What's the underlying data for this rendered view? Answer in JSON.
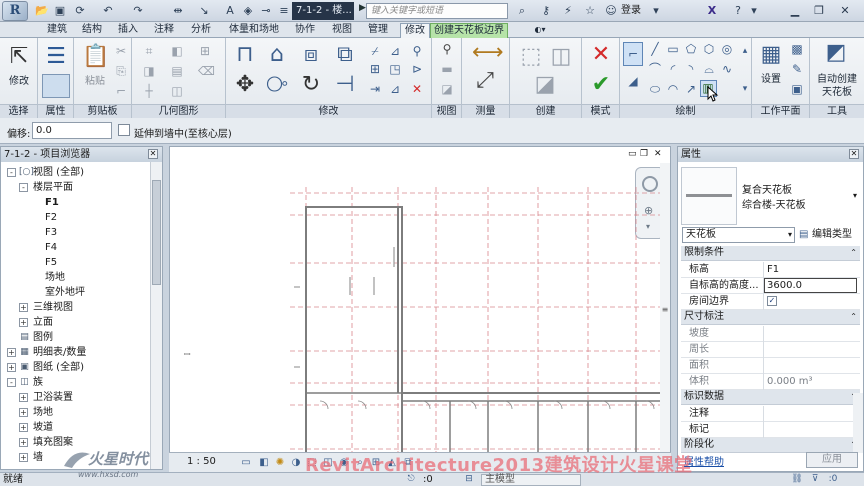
{
  "titlebar": {
    "logo": "R",
    "document_title": "7-1-2 - 楼...",
    "search_placeholder": "键入关键字或短语",
    "login": "登录"
  },
  "tabs": [
    "建筑",
    "结构",
    "插入",
    "注释",
    "分析",
    "体量和场地",
    "协作",
    "视图",
    "管理",
    "修改",
    "创建天花板边界"
  ],
  "tabs_state": {
    "active": "修改",
    "context": "创建天花板边界"
  },
  "ribbon": {
    "panels": {
      "select": "选择",
      "properties": "属性",
      "clipboard": "剪贴板",
      "geometry": "几何图形",
      "modify": "修改",
      "view": "视图",
      "measure": "测量",
      "create": "创建",
      "mode": "模式",
      "draw": "绘制",
      "workplane": "工作平面",
      "tools": "工具"
    },
    "buttons": {
      "modify": "修改",
      "paste": "粘贴",
      "set": "设置",
      "auto_ceiling_line1": "自动创建",
      "auto_ceiling_line2": "天花板"
    }
  },
  "options_bar": {
    "offset_label": "偏移:",
    "offset_value": "0.0",
    "extend_label": "延伸到墙中(至核心层)"
  },
  "project_browser": {
    "title": "7-1-2 - 项目浏览器",
    "items": [
      {
        "label": "视图 (全部)",
        "level": 0,
        "toggle": "-",
        "icon": "[○]"
      },
      {
        "label": "楼层平面",
        "level": 1,
        "toggle": "-"
      },
      {
        "label": "F1",
        "level": 2,
        "bold": true
      },
      {
        "label": "F2",
        "level": 2
      },
      {
        "label": "F3",
        "level": 2
      },
      {
        "label": "F4",
        "level": 2
      },
      {
        "label": "F5",
        "level": 2
      },
      {
        "label": "场地",
        "level": 2
      },
      {
        "label": "室外地坪",
        "level": 2
      },
      {
        "label": "三维视图",
        "level": 1,
        "toggle": "+"
      },
      {
        "label": "立面",
        "level": 1,
        "toggle": "+"
      },
      {
        "label": "图例",
        "level": 0,
        "icon": "▤"
      },
      {
        "label": "明细表/数量",
        "level": 0,
        "toggle": "+",
        "icon": "▦"
      },
      {
        "label": "图纸 (全部)",
        "level": 0,
        "toggle": "+",
        "icon": "▣"
      },
      {
        "label": "族",
        "level": 0,
        "toggle": "-",
        "icon": "◫"
      },
      {
        "label": "卫浴装置",
        "level": 1,
        "toggle": "+"
      },
      {
        "label": "场地",
        "level": 1,
        "toggle": "+"
      },
      {
        "label": "坡道",
        "level": 1,
        "toggle": "+"
      },
      {
        "label": "填充图案",
        "level": 1,
        "toggle": "+"
      },
      {
        "label": "墙",
        "level": 1,
        "toggle": "+"
      }
    ]
  },
  "view": {
    "scale": "1 : 50",
    "viewcube_icon": "steering-wheel"
  },
  "properties": {
    "title": "属性",
    "type_name_line1": "复合天花板",
    "type_name_line2": "综合楼-天花板",
    "family_select": "天花板",
    "edit_type": "编辑类型",
    "sections": [
      {
        "name": "限制条件",
        "rows": [
          {
            "name": "标高",
            "value": "F1"
          },
          {
            "name": "自标高的高度...",
            "value": "3600.0",
            "editing": true
          },
          {
            "name": "房间边界",
            "value": "",
            "checkbox": true,
            "checked": true
          }
        ]
      },
      {
        "name": "尺寸标注",
        "rows": [
          {
            "name": "坡度",
            "value": "",
            "dim": true
          },
          {
            "name": "周长",
            "value": "",
            "dim": true
          },
          {
            "name": "面积",
            "value": "",
            "dim": true
          },
          {
            "name": "体积",
            "value": "0.000 m³",
            "dim": true
          }
        ]
      },
      {
        "name": "标识数据",
        "rows": [
          {
            "name": "注释",
            "value": ""
          },
          {
            "name": "标记",
            "value": ""
          }
        ]
      },
      {
        "name": "阶段化",
        "rows": []
      }
    ],
    "help_link": "属性帮助",
    "apply_button": "应用"
  },
  "statusbar": {
    "text": "就绪",
    "zero_value": ":0",
    "model_select": "主模型"
  },
  "watermarks": {
    "logo_text": "火星时代",
    "url": "www.hxsd.com",
    "course": "RevitArchitecture2013建筑设计火星课堂"
  },
  "colors": {
    "context_tab": "#b6e3a8",
    "accent": "#3d5f8c",
    "plan_red": "#d9868c",
    "watermark": "#e86e78"
  }
}
